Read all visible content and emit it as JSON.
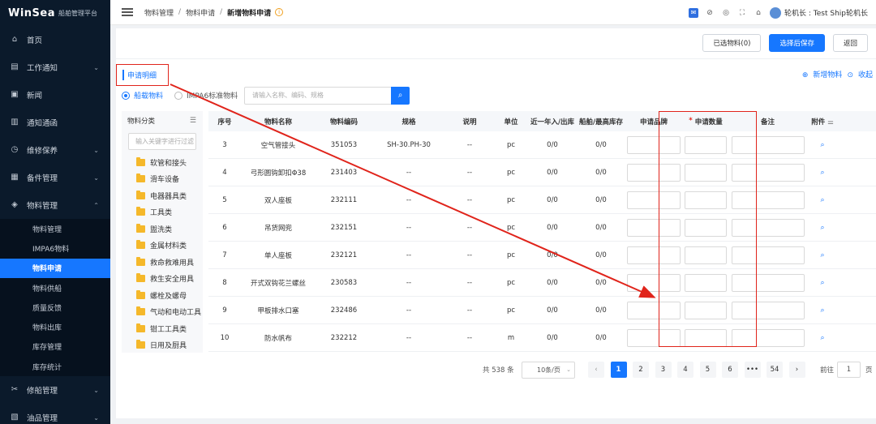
{
  "app": {
    "brand": "WinSea",
    "subtitle": "船舶管理平台"
  },
  "sidebar": {
    "items": [
      {
        "label": "首页",
        "icon": "home-icon"
      },
      {
        "label": "工作通知",
        "icon": "notice-icon",
        "chevron": "⌄"
      },
      {
        "label": "新闻",
        "icon": "news-icon"
      },
      {
        "label": "通知通函",
        "icon": "circular-icon"
      },
      {
        "label": "维修保养",
        "icon": "maintenance-icon",
        "chevron": "⌄"
      },
      {
        "label": "备件管理",
        "icon": "spare-icon",
        "chevron": "⌄"
      },
      {
        "label": "物料管理",
        "icon": "material-icon",
        "chevron": "⌃"
      }
    ],
    "subitems": [
      "物料管理",
      "IMPA6物料",
      "物料申请",
      "物料供船",
      "质量反馈",
      "物料出库",
      "库存管理",
      "库存统计"
    ],
    "active_sub": "物料申请",
    "bottom_items": [
      {
        "label": "修船管理",
        "icon": "repair-icon",
        "chevron": "⌄"
      },
      {
        "label": "油品管理",
        "icon": "oil-icon",
        "chevron": "⌄"
      }
    ]
  },
  "topbar": {
    "breadcrumb": [
      "物料管理",
      "物料申请",
      "新增物料申请"
    ],
    "user": "轮机长 : Test Ship轮机长"
  },
  "actions": {
    "selected_label": "已选物料(0)",
    "save_label": "选择后保存",
    "back_label": "返回"
  },
  "section": {
    "title": "申请明细",
    "add_link": "新增物料",
    "collapse_link": "收起"
  },
  "filters": {
    "radio_ship": "船载物料",
    "radio_impa": "IMPA6标准物料",
    "search_placeholder": "请输入名称、编码、规格"
  },
  "tree": {
    "header": "物料分类",
    "search_placeholder": "输入关键字进行过滤",
    "items": [
      "软管和接头",
      "滑车设备",
      "电器器具类",
      "工具类",
      "盥洗类",
      "金属材料类",
      "救命救难用具",
      "救生安全用具",
      "螺栓及螺母",
      "气动和电动工具",
      "钳工工具类",
      "日用及厨具"
    ]
  },
  "table": {
    "headers": {
      "no": "序号",
      "name": "物料名称",
      "code": "物料编码",
      "spec": "规格",
      "desc": "说明",
      "unit": "单位",
      "io": "近一年入/出库",
      "stock": "船舶/最高库存",
      "brand": "申请品牌",
      "qty": "申请数量",
      "note": "备注",
      "attachment": "附件"
    },
    "rows": [
      {
        "no": "3",
        "name": "空气管接头",
        "code": "351053",
        "spec": "SH-30.PH-30",
        "desc": "--",
        "unit": "pc",
        "io": "0/0",
        "stock": "0/0"
      },
      {
        "no": "4",
        "name": "弓形圆钩卸扣Φ38",
        "code": "231403",
        "spec": "--",
        "desc": "--",
        "unit": "pc",
        "io": "0/0",
        "stock": "0/0"
      },
      {
        "no": "5",
        "name": "双人座板",
        "code": "232111",
        "spec": "--",
        "desc": "--",
        "unit": "pc",
        "io": "0/0",
        "stock": "0/0"
      },
      {
        "no": "6",
        "name": "吊货网兜",
        "code": "232151",
        "spec": "--",
        "desc": "--",
        "unit": "pc",
        "io": "0/0",
        "stock": "0/0"
      },
      {
        "no": "7",
        "name": "单人座板",
        "code": "232121",
        "spec": "--",
        "desc": "--",
        "unit": "pc",
        "io": "0/0",
        "stock": "0/0"
      },
      {
        "no": "8",
        "name": "开式双钩花兰螺丝",
        "code": "230583",
        "spec": "--",
        "desc": "--",
        "unit": "pc",
        "io": "0/0",
        "stock": "0/0"
      },
      {
        "no": "9",
        "name": "甲板排水口塞",
        "code": "232486",
        "spec": "--",
        "desc": "--",
        "unit": "pc",
        "io": "0/0",
        "stock": "0/0"
      },
      {
        "no": "10",
        "name": "防水帆布",
        "code": "232212",
        "spec": "--",
        "desc": "--",
        "unit": "m",
        "io": "0/0",
        "stock": "0/0"
      }
    ]
  },
  "pagination": {
    "total": "共 538 条",
    "page_size": "10条/页",
    "pages": [
      "1",
      "2",
      "3",
      "4",
      "5",
      "6",
      "•••",
      "54"
    ],
    "current": "1",
    "goto_label": "前往",
    "goto_value": "1",
    "goto_unit": "页"
  },
  "colors": {
    "accent": "#1677ff",
    "annotation": "#e0241b",
    "sidebar": "#0b1a2b"
  }
}
